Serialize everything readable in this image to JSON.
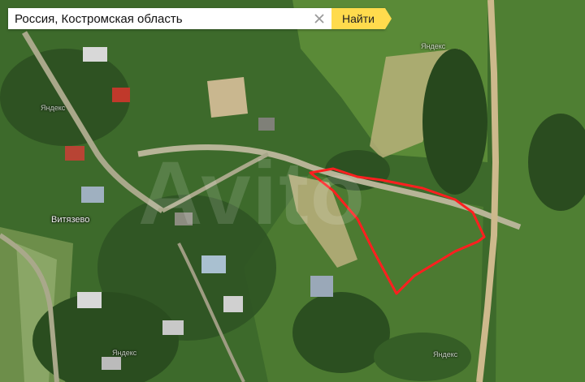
{
  "search": {
    "value": "Россия, Костромская область",
    "button_label": "Найти",
    "clear_icon": "close-icon",
    "button_color": "#ffdb4d"
  },
  "map": {
    "place_label": "Витязево",
    "provider_watermark": "Яндекс",
    "overlay_watermark": "Avito",
    "plot_outline_color": "#ff1f1f"
  }
}
